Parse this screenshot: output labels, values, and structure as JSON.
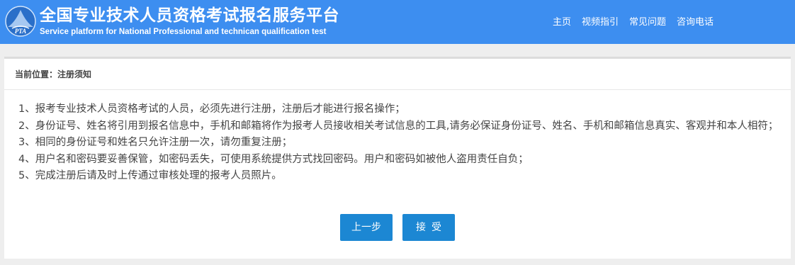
{
  "header": {
    "logo_text": "PTA",
    "title": "全国专业技术人员资格考试报名服务平台",
    "subtitle": "Service platform for National Professional and technican qualification test",
    "nav": [
      {
        "label": "主页"
      },
      {
        "label": "视频指引"
      },
      {
        "label": "常见问题"
      },
      {
        "label": "咨询电话"
      }
    ]
  },
  "breadcrumb": "当前位置：注册须知",
  "notice": [
    "1、报考专业技术人员资格考试的人员，必须先进行注册，注册后才能进行报名操作；",
    "2、身份证号、姓名将引用到报名信息中，手机和邮箱将作为报考人员接收相关考试信息的工具,请务必保证身份证号、姓名、手机和邮箱信息真实、客观并和本人相符；",
    "3、相同的身份证号和姓名只允许注册一次，请勿重复注册；",
    "4、用户名和密码要妥善保管，如密码丢失，可使用系统提供方式找回密码。用户和密码如被他人盗用责任自负；",
    "5、完成注册后请及时上传通过审核处理的报考人员照片。"
  ],
  "buttons": {
    "prev": "上一步",
    "accept": "接受"
  },
  "colors": {
    "header_bg": "#3d8ef0",
    "button_bg": "#1c87d3"
  }
}
